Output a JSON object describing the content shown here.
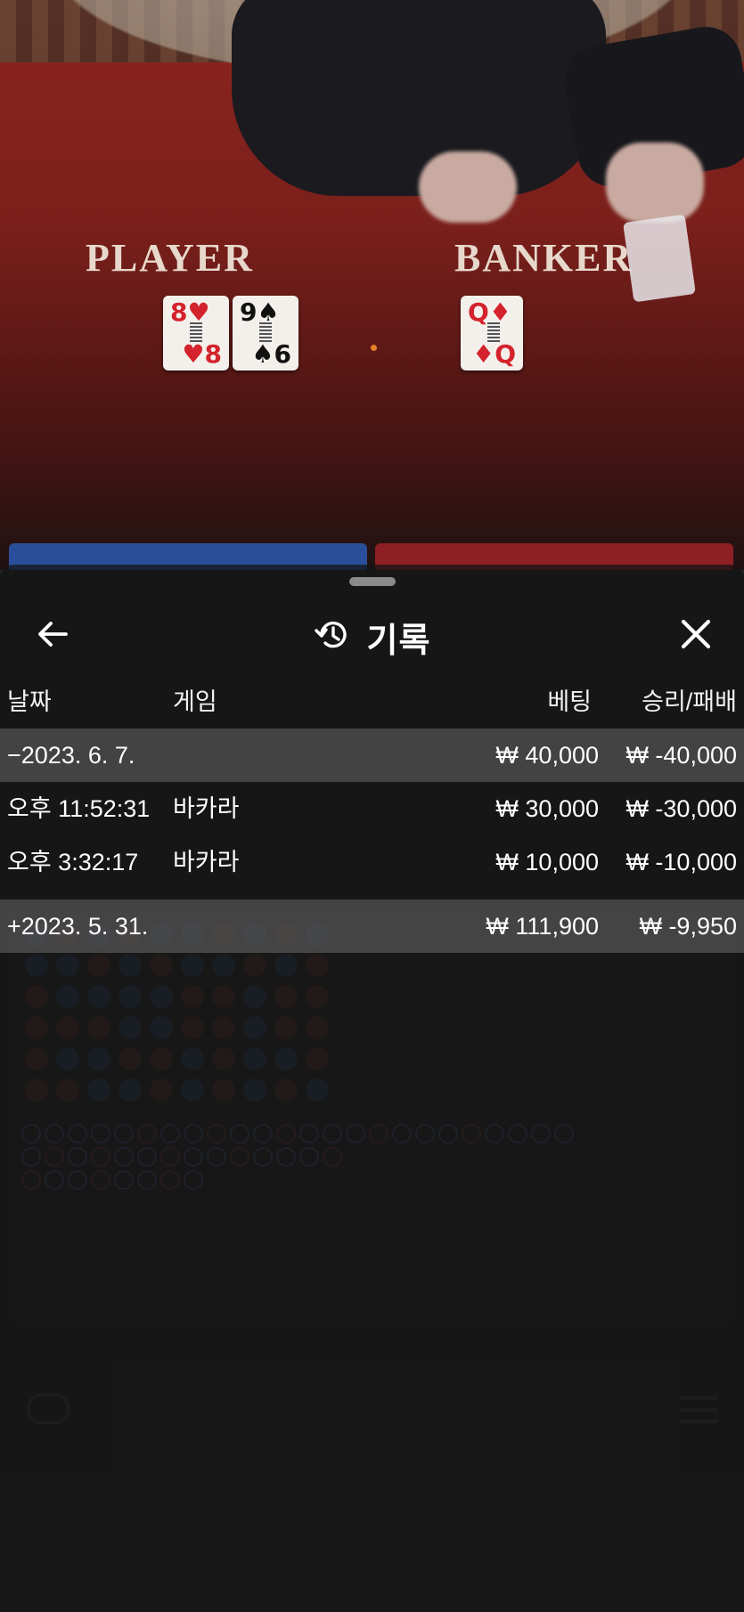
{
  "video": {
    "player_label": "PLAYER",
    "banker_label": "BANKER",
    "player_cards": [
      {
        "rank": "8",
        "suit": "♥",
        "color": "red"
      },
      {
        "rank": "9",
        "suit": "♠",
        "color": "black"
      }
    ],
    "player_cards_bottom": [
      "8",
      "6"
    ],
    "banker_cards": [
      {
        "rank": "Q",
        "suit": "♦",
        "color": "red"
      }
    ],
    "banker_cards_bottom": [
      "Q"
    ]
  },
  "history": {
    "title": "기록",
    "columns": {
      "date": "날짜",
      "game": "게임",
      "bet": "베팅",
      "win_loss": "승리/패배"
    },
    "rows": [
      {
        "type": "group",
        "date": "−2023. 6. 7.",
        "game": "",
        "bet": "₩ 40,000",
        "win_loss": "₩ -40,000"
      },
      {
        "type": "item",
        "date": "오후 11:52:31",
        "game": "바카라",
        "bet": "₩ 30,000",
        "win_loss": "₩ -30,000"
      },
      {
        "type": "item",
        "date": "오후 3:32:17",
        "game": "바카라",
        "bet": "₩ 10,000",
        "win_loss": "₩ -10,000"
      },
      {
        "type": "group",
        "date": "+2023. 5. 31.",
        "game": "",
        "bet": "₩ 111,900",
        "win_loss": "₩ -9,950"
      }
    ]
  },
  "colors": {
    "sheet_bg": "#121212",
    "group_row_bg": "#696969",
    "table_felt": "#8c2520",
    "player_blue": "#2a4f9a",
    "banker_red": "#8e1f24"
  },
  "icons": {
    "back": "arrow-left-icon",
    "history": "history-clock-icon",
    "close": "close-x-icon"
  }
}
